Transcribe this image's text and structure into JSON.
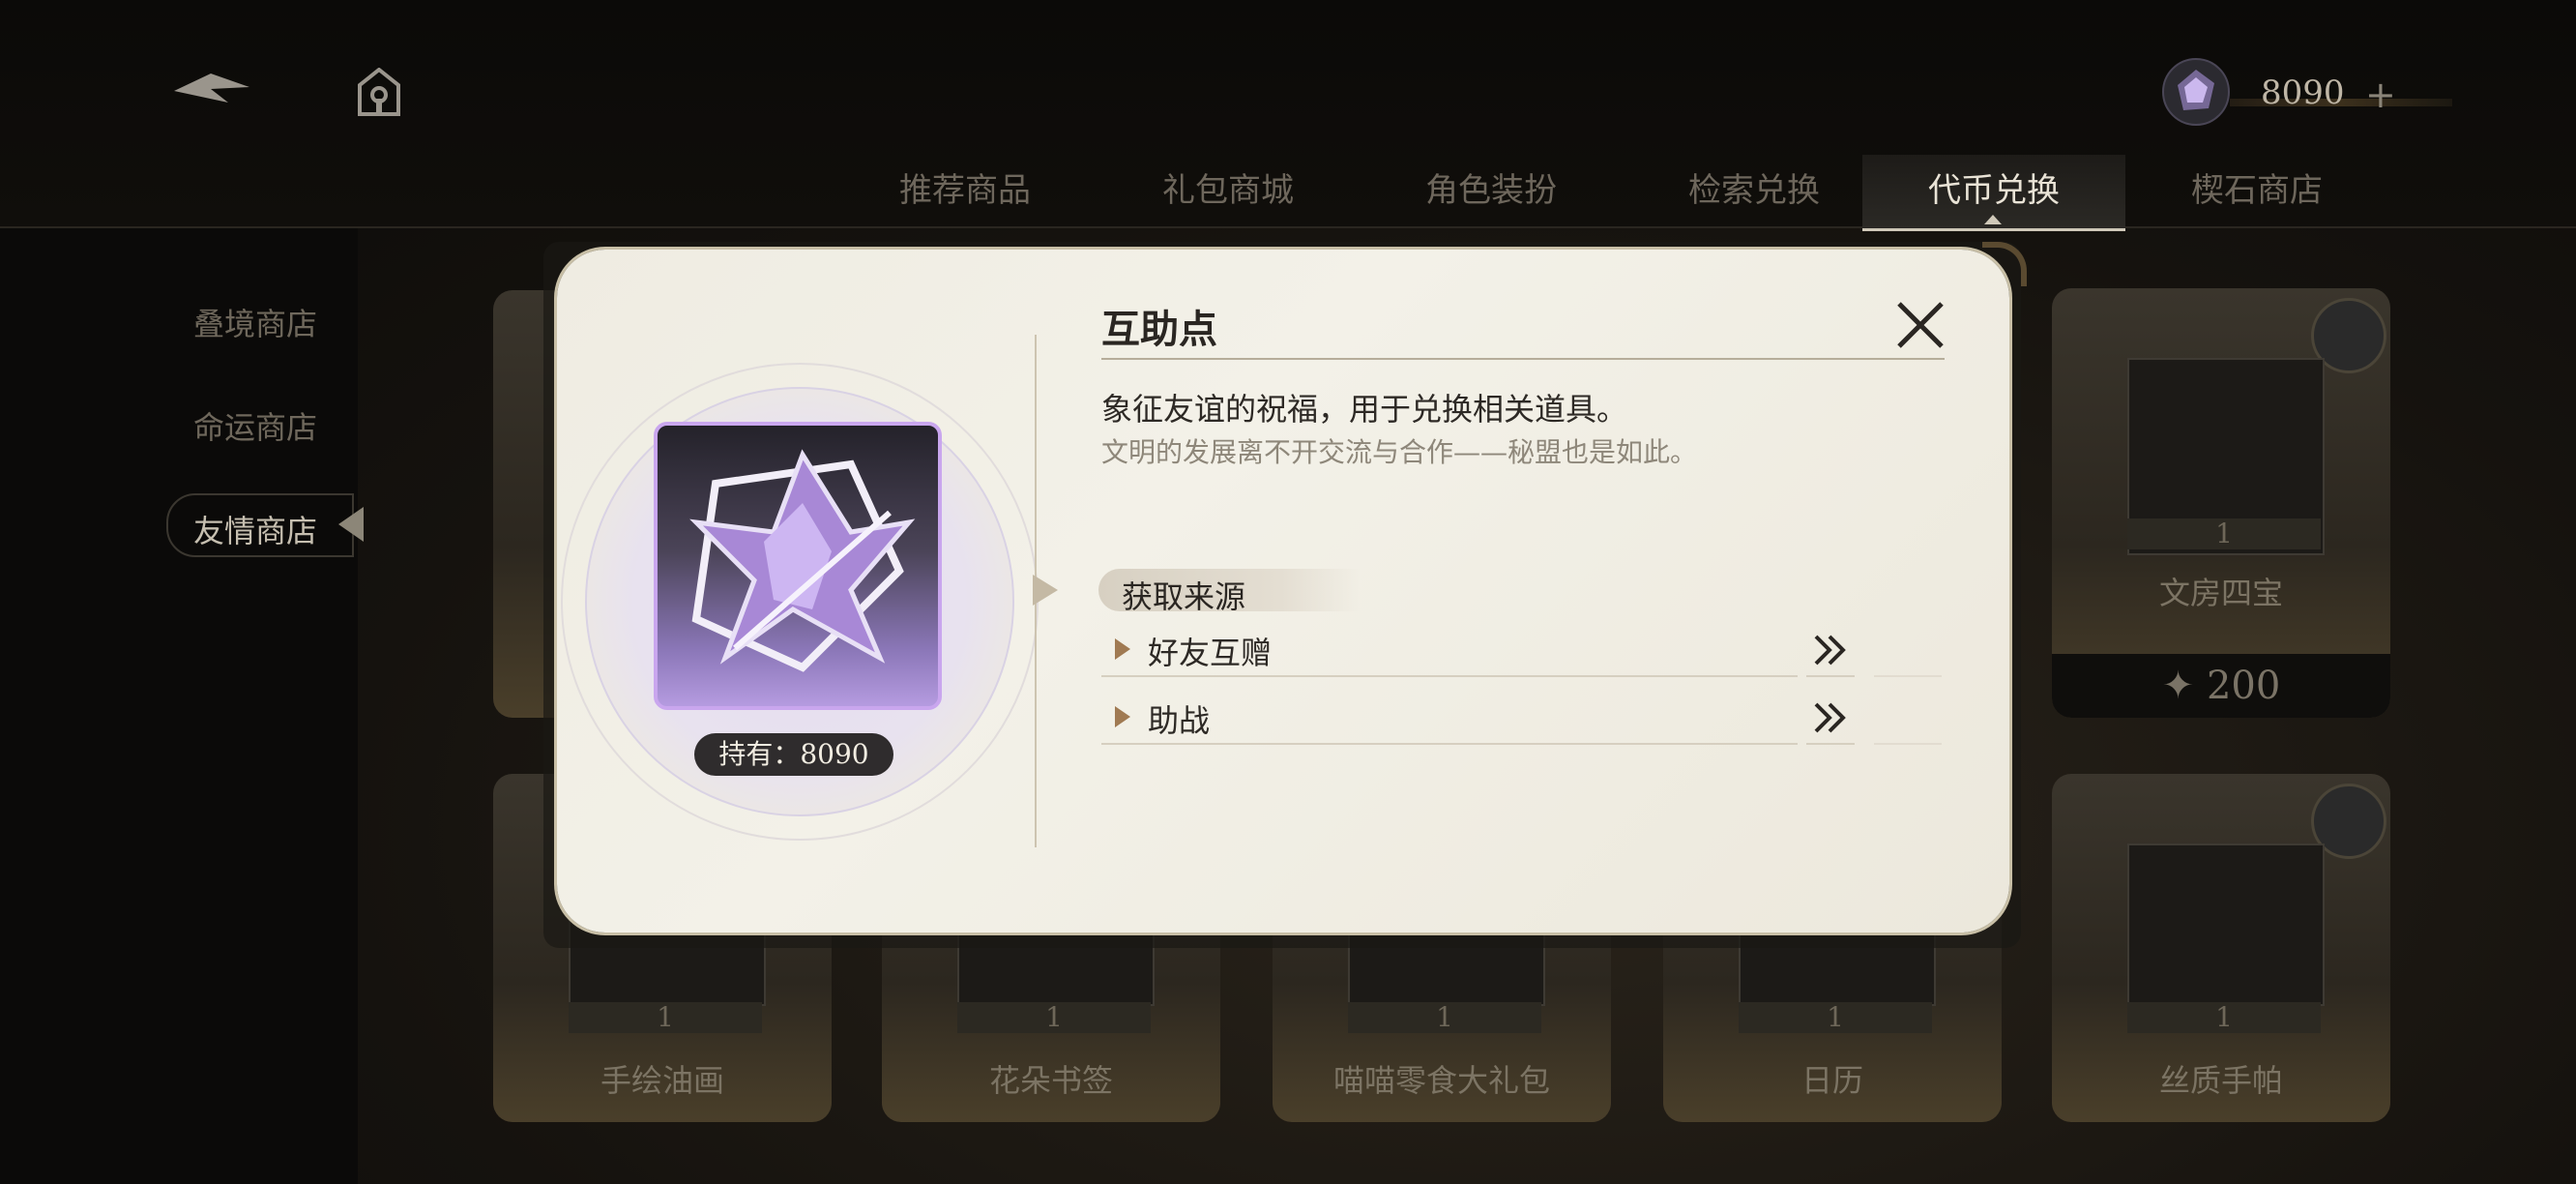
{
  "header": {
    "currency_value": "8090",
    "plus_label": "+",
    "tabs": [
      {
        "label": "推荐商品"
      },
      {
        "label": "礼包商城"
      },
      {
        "label": "角色装扮"
      },
      {
        "label": "检索兑换"
      },
      {
        "label": "代币兑换"
      },
      {
        "label": "楔石商店"
      }
    ],
    "active_tab": "代币兑换"
  },
  "sidebar": {
    "items": [
      {
        "label": "叠境商店"
      },
      {
        "label": "命运商店"
      },
      {
        "label": "友情商店"
      }
    ],
    "active_item": "友情商店"
  },
  "products": [
    {
      "name": "文房四宝",
      "qty": "1",
      "price": "200"
    },
    {
      "name": "手绘油画",
      "qty": "1"
    },
    {
      "name": "花朵书签",
      "qty": "1"
    },
    {
      "name": "喵喵零食大礼包",
      "qty": "1"
    },
    {
      "name": "日历",
      "qty": "1"
    },
    {
      "name": "丝质手帕",
      "qty": "1"
    }
  ],
  "modal": {
    "title": "互助点",
    "description": "象征友谊的祝福，用于兑换相关道具。",
    "lore": "文明的发展离不开交流与合作——秘盟也是如此。",
    "hold_text": "持有：8090",
    "source_heading": "获取来源",
    "sources": [
      {
        "label": "好友互赠"
      },
      {
        "label": "助战"
      }
    ]
  },
  "colors": {
    "accent_purple": "#b59be0",
    "modal_bg": "#efece2",
    "text_dark": "#2a2622"
  }
}
